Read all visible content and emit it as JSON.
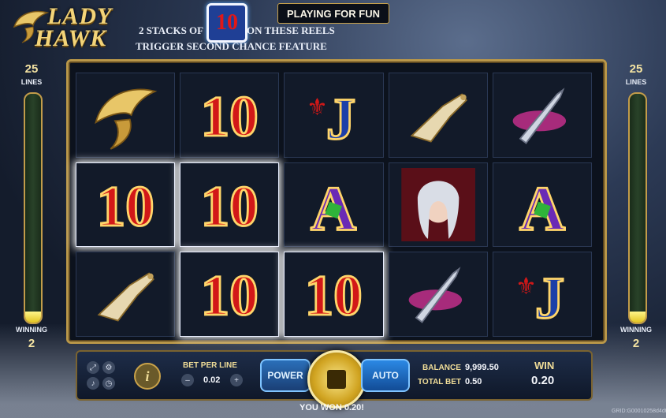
{
  "logo": {
    "line1": "LADY",
    "line2": "HAWK"
  },
  "banner": {
    "line1a": "2 STACKS OF",
    "symbol": "10",
    "line1b": "ON THESE REELS",
    "line2": "TRIGGER SECOND CHANCE FEATURE"
  },
  "mode_label": "PLAYING FOR FUN",
  "left_meter": {
    "lines_value": "25",
    "lines_label": "LINES",
    "winning_label": "WINNING",
    "winning_value": "2",
    "fill_fraction": 0.05
  },
  "right_meter": {
    "lines_value": "25",
    "lines_label": "LINES",
    "winning_label": "WINNING",
    "winning_value": "2",
    "fill_fraction": 0.05
  },
  "reels": [
    [
      "hawk",
      "10",
      "J",
      "gauntlet",
      "dagger"
    ],
    [
      "10",
      "10",
      "A",
      "lady",
      "A"
    ],
    [
      "gauntlet",
      "10",
      "10",
      "dagger",
      "J"
    ]
  ],
  "winning_cells": [
    [
      1,
      0
    ],
    [
      1,
      1
    ],
    [
      2,
      1
    ],
    [
      2,
      2
    ]
  ],
  "controls": {
    "bet_per_line_label": "BET PER LINE",
    "bet_per_line_value": "0.02",
    "power_label": "POWER",
    "auto_label": "AUTO",
    "balance_label": "BALANCE",
    "balance_value": "9,999.50",
    "total_bet_label": "TOTAL BET",
    "total_bet_value": "0.50",
    "win_label": "WIN",
    "win_value": "0.20",
    "info_label": "i"
  },
  "footer": {
    "message": "YOU WON 0.20!",
    "grid_id": "GRID:G00010258d4d0"
  },
  "colors": {
    "gold": "#c9a24a",
    "red_ten": "#d21818",
    "blue_j": "#1c3fa8",
    "purple_a": "#6a2ab5"
  }
}
